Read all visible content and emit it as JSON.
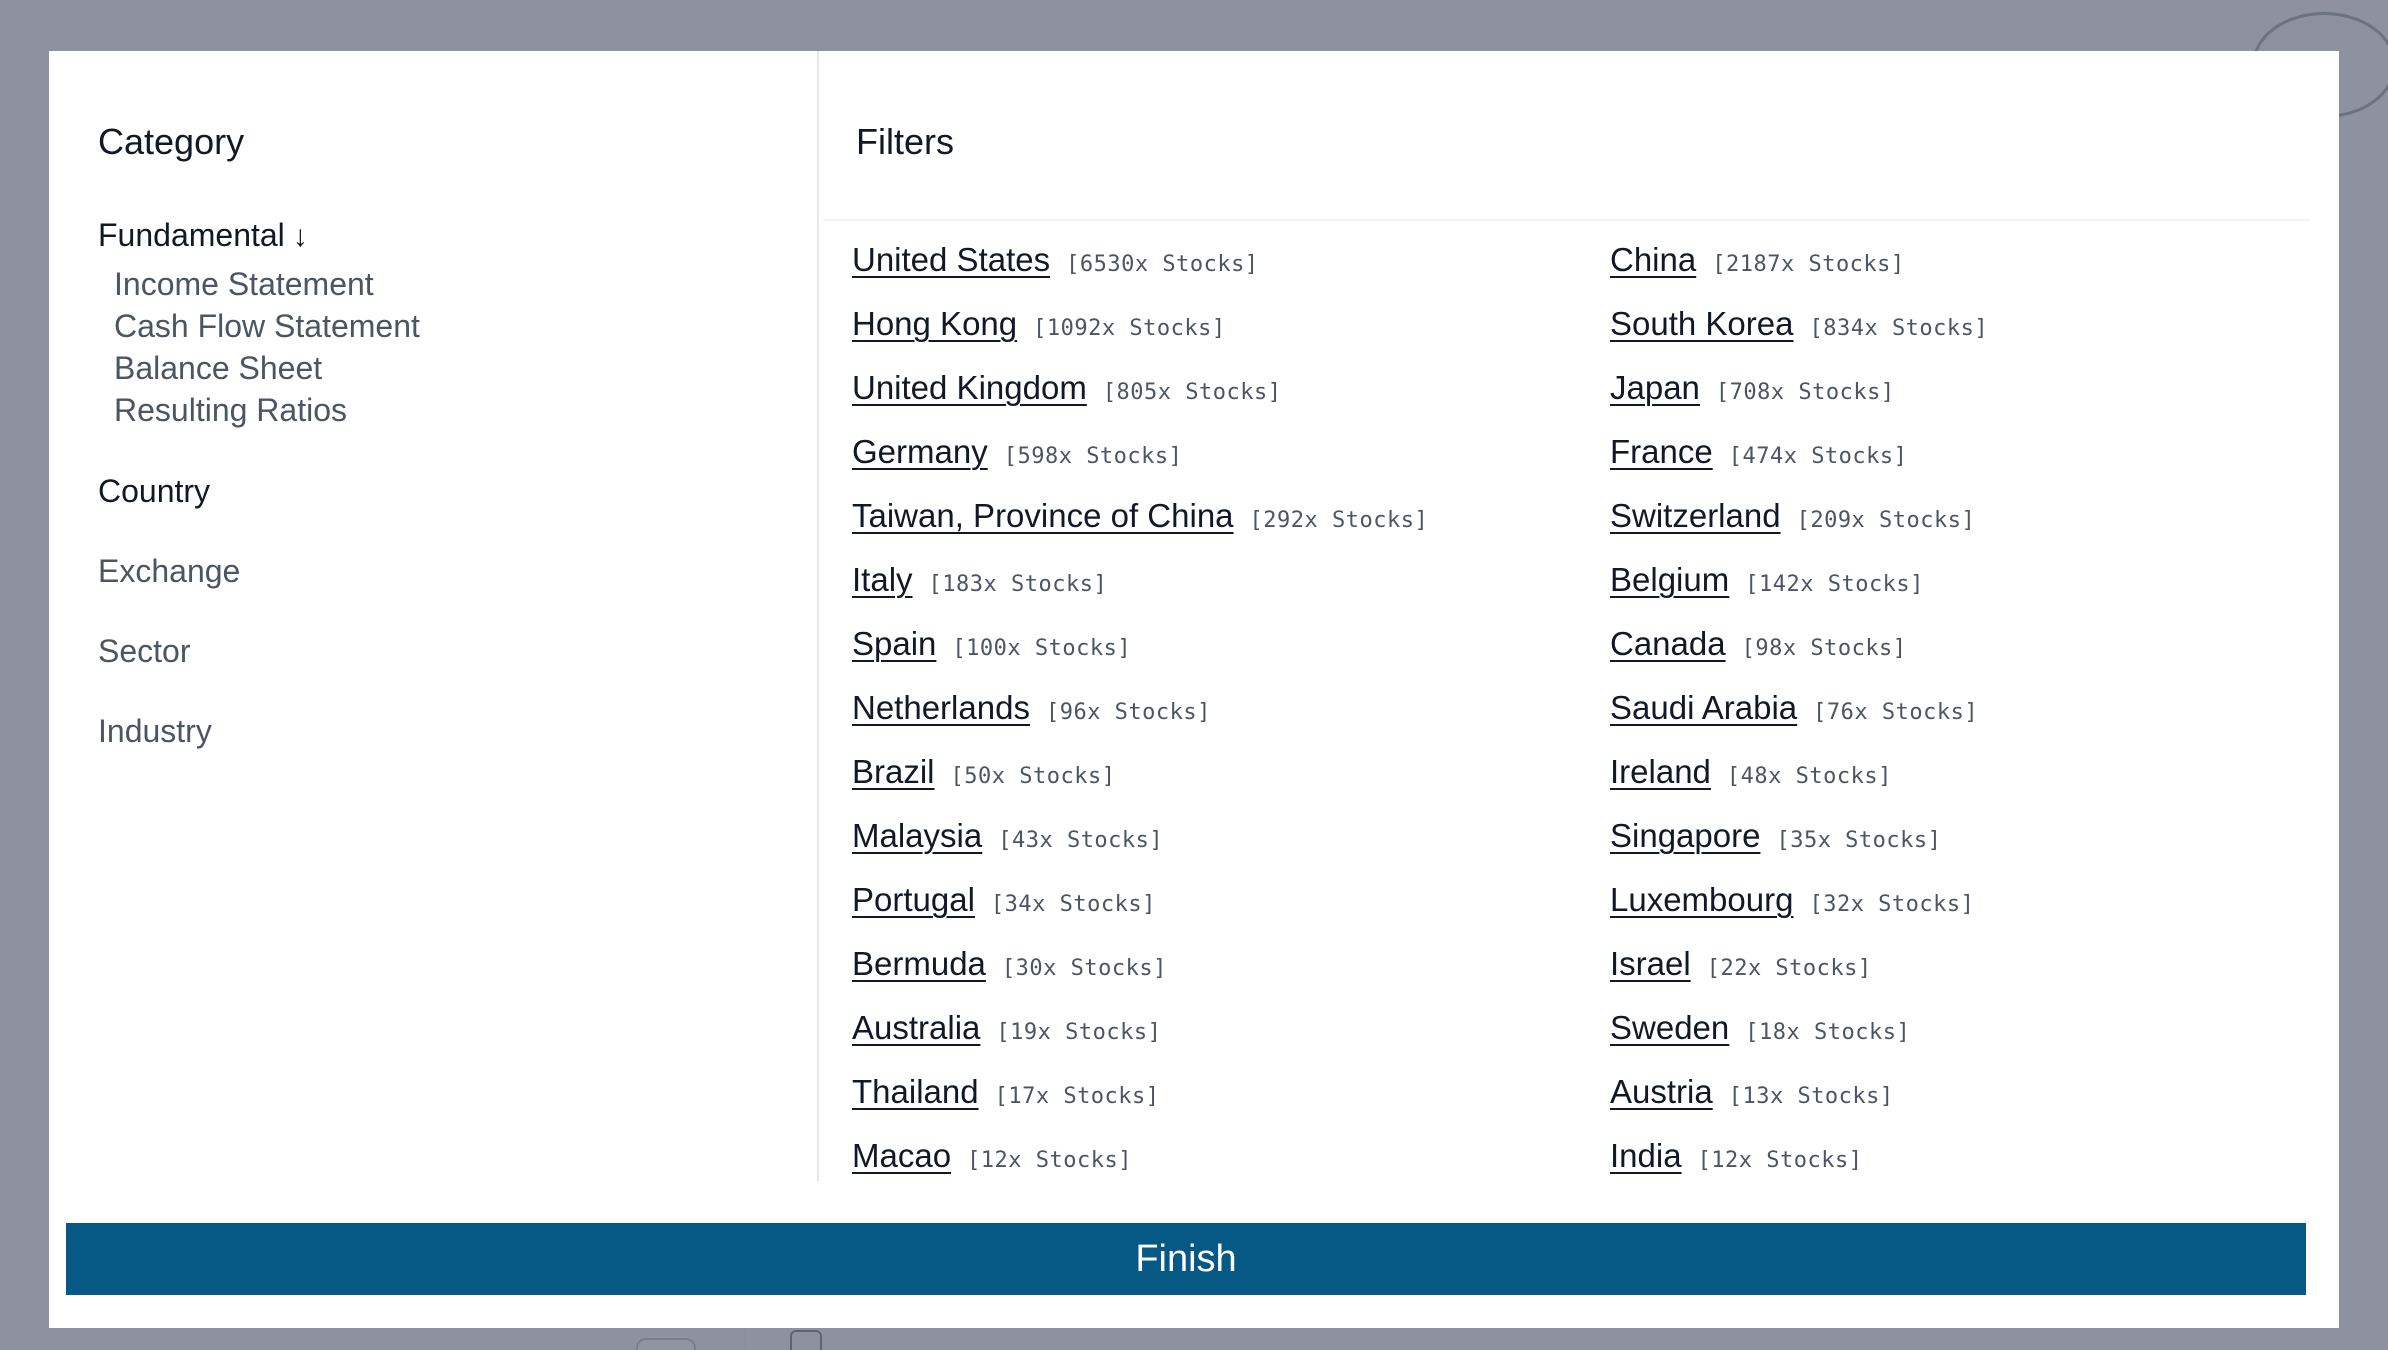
{
  "category_panel": {
    "heading": "Category",
    "items": [
      {
        "label": "Fundamental",
        "arrow": "↓",
        "expanded": true,
        "children": [
          "Income Statement",
          "Cash Flow Statement",
          "Balance Sheet",
          "Resulting Ratios"
        ]
      },
      {
        "label": "Country",
        "active": true
      },
      {
        "label": "Exchange"
      },
      {
        "label": "Sector"
      },
      {
        "label": "Industry"
      }
    ]
  },
  "filters_panel": {
    "heading": "Filters",
    "options": [
      {
        "name": "United States",
        "count": "[6530x Stocks]"
      },
      {
        "name": "China",
        "count": "[2187x Stocks]"
      },
      {
        "name": "Hong Kong",
        "count": "[1092x Stocks]"
      },
      {
        "name": "South Korea",
        "count": "[834x Stocks]"
      },
      {
        "name": "United Kingdom",
        "count": "[805x Stocks]"
      },
      {
        "name": "Japan",
        "count": "[708x Stocks]"
      },
      {
        "name": "Germany",
        "count": "[598x Stocks]"
      },
      {
        "name": "France",
        "count": "[474x Stocks]"
      },
      {
        "name": "Taiwan, Province of China",
        "count": "[292x Stocks]"
      },
      {
        "name": "Switzerland",
        "count": "[209x Stocks]"
      },
      {
        "name": "Italy",
        "count": "[183x Stocks]"
      },
      {
        "name": "Belgium",
        "count": "[142x Stocks]"
      },
      {
        "name": "Spain",
        "count": "[100x Stocks]"
      },
      {
        "name": "Canada",
        "count": "[98x Stocks]"
      },
      {
        "name": "Netherlands",
        "count": "[96x Stocks]"
      },
      {
        "name": "Saudi Arabia",
        "count": "[76x Stocks]"
      },
      {
        "name": "Brazil",
        "count": "[50x Stocks]"
      },
      {
        "name": "Ireland",
        "count": "[48x Stocks]"
      },
      {
        "name": "Malaysia",
        "count": "[43x Stocks]"
      },
      {
        "name": "Singapore",
        "count": "[35x Stocks]"
      },
      {
        "name": "Portugal",
        "count": "[34x Stocks]"
      },
      {
        "name": "Luxembourg",
        "count": "[32x Stocks]"
      },
      {
        "name": "Bermuda",
        "count": "[30x Stocks]"
      },
      {
        "name": "Israel",
        "count": "[22x Stocks]"
      },
      {
        "name": "Australia",
        "count": "[19x Stocks]"
      },
      {
        "name": "Sweden",
        "count": "[18x Stocks]"
      },
      {
        "name": "Thailand",
        "count": "[17x Stocks]"
      },
      {
        "name": "Austria",
        "count": "[13x Stocks]"
      },
      {
        "name": "Macao",
        "count": "[12x Stocks]"
      },
      {
        "name": "India",
        "count": "[12x Stocks]"
      }
    ]
  },
  "finish_button": {
    "label": "Finish"
  },
  "colors": {
    "finish_bg": "#075985",
    "overlay": "#6b7280",
    "text_primary": "#111827",
    "text_secondary": "#4b5563"
  },
  "icons": {
    "menu": "menu-icon",
    "arrow_down": "arrow-down-icon"
  }
}
